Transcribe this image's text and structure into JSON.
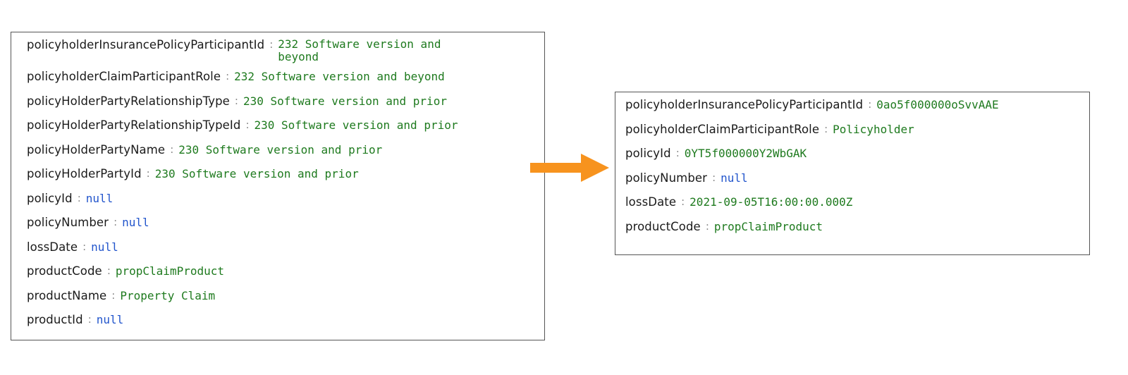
{
  "left_panel": {
    "rows": [
      {
        "key": "policyholderInsurancePolicyParticipantId",
        "value": "232 Software version and beyond",
        "type": "str"
      },
      {
        "key": "policyholderClaimParticipantRole",
        "value": "232 Software version and beyond",
        "type": "str"
      },
      {
        "key": "policyHolderPartyRelationshipType",
        "value": "230 Software version and prior",
        "type": "str"
      },
      {
        "key": "policyHolderPartyRelationshipTypeId",
        "value": "230 Software version and prior",
        "type": "str"
      },
      {
        "key": "policyHolderPartyName",
        "value": "230 Software version and prior",
        "type": "str"
      },
      {
        "key": "policyHolderPartyId",
        "value": "230 Software version and prior",
        "type": "str"
      },
      {
        "key": "policyId",
        "value": "null",
        "type": "null"
      },
      {
        "key": "policyNumber",
        "value": "null",
        "type": "null"
      },
      {
        "key": "lossDate",
        "value": "null",
        "type": "null"
      },
      {
        "key": "productCode",
        "value": "propClaimProduct",
        "type": "str"
      },
      {
        "key": "productName",
        "value": "Property Claim",
        "type": "str"
      },
      {
        "key": "productId",
        "value": "null",
        "type": "null"
      }
    ]
  },
  "right_panel": {
    "rows": [
      {
        "key": "policyholderInsurancePolicyParticipantId",
        "value": "0ao5f000000oSvvAAE",
        "type": "str"
      },
      {
        "key": "policyholderClaimParticipantRole",
        "value": "Policyholder",
        "type": "str"
      },
      {
        "key": "policyId",
        "value": "0YT5f000000Y2WbGAK",
        "type": "str"
      },
      {
        "key": "policyNumber",
        "value": "null",
        "type": "null"
      },
      {
        "key": "lossDate",
        "value": "2021-09-05T16:00:00.000Z",
        "type": "str"
      },
      {
        "key": "productCode",
        "value": "propClaimProduct",
        "type": "str"
      }
    ]
  },
  "separator": ":",
  "arrow": {
    "icon": "right-arrow-icon",
    "color": "#f7931e"
  }
}
